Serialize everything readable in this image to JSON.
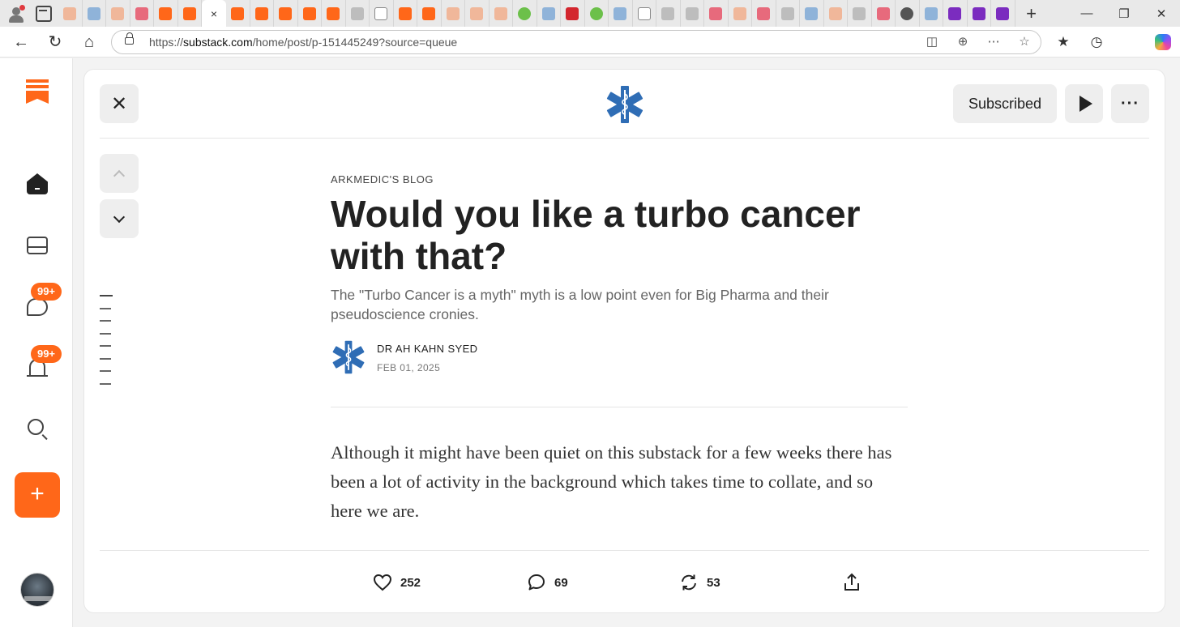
{
  "browser": {
    "tab_count_visible": 40,
    "active_tab_close": "×",
    "new_tab_label": "+",
    "window_controls": [
      "—",
      "❐",
      "✕"
    ],
    "url": {
      "prefix": "https://",
      "host": "substack.com",
      "path": "/home/post/p-151445249?source=queue"
    }
  },
  "rail": {
    "chat_badge": "99+",
    "bell_badge": "99+",
    "create_label": "+"
  },
  "header": {
    "close_label": "✕",
    "subscribed_label": "Subscribed",
    "more_label": "···"
  },
  "article": {
    "publication": "ARKMEDIC'S BLOG",
    "title": "Would you like a turbo cancer with that?",
    "subtitle": "The \"Turbo Cancer is a myth\" myth is a low point even for Big Pharma and their pseudoscience cronies.",
    "author": "DR AH KAHN SYED",
    "date": "FEB 01, 2025",
    "body": "Although it might have been quiet on this substack for a few weeks there has been a lot of activity in the background which takes time to collate, and so here we are."
  },
  "actions": {
    "likes": "252",
    "comments": "69",
    "restacks": "53"
  },
  "colors": {
    "accent": "#ff6719",
    "star_of_life": "#2f6db5"
  }
}
